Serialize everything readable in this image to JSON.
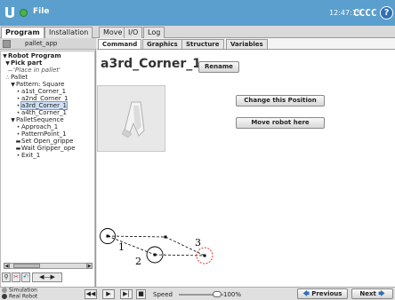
{
  "titlebar": {
    "file_label": "File",
    "time": "12:47:15",
    "robot_name": "CCCC",
    "help_label": "?"
  },
  "main_tabs": [
    "Program",
    "Installation",
    "Move",
    "I/O",
    "Log"
  ],
  "app": {
    "name": "pallet_app"
  },
  "tree": [
    {
      "label": "Robot Program",
      "glyph": "▼",
      "style": "bold"
    },
    {
      "label": "Pick part",
      "glyph": "▼",
      "style": "bold"
    },
    {
      "label": "'Place in pallet'",
      "glyph": "—",
      "style": "italic"
    },
    {
      "label": "Pallet",
      "glyph": "∴",
      "style": ""
    },
    {
      "label": "Pattern: Square",
      "glyph": "▼",
      "style": ""
    },
    {
      "label": "a1st_Corner_1",
      "glyph": "•",
      "style": ""
    },
    {
      "label": "a2nd_Corner_1",
      "glyph": "•",
      "style": ""
    },
    {
      "label": "a3rd_Corner_1",
      "glyph": "•",
      "style": "selected"
    },
    {
      "label": "a4th_Corner_1",
      "glyph": "•",
      "style": ""
    },
    {
      "label": "PalletSequence",
      "glyph": "▼",
      "style": ""
    },
    {
      "label": "Approach_1",
      "glyph": "•",
      "style": ""
    },
    {
      "label": "PatternPoint_1",
      "glyph": "•",
      "style": ""
    },
    {
      "label": "Set Open_grippe",
      "glyph": "▬",
      "style": ""
    },
    {
      "label": "Wait Gripper_ope",
      "glyph": "▬",
      "style": ""
    },
    {
      "label": "Exit_1",
      "glyph": "•",
      "style": ""
    }
  ],
  "sub_tabs": [
    "Command",
    "Graphics",
    "Structure",
    "Variables"
  ],
  "waypoint": {
    "name": "a3rd_Corner_1",
    "rename_label": "Rename",
    "change_label": "Change this Position",
    "move_label": "Move robot here"
  },
  "diagram_labels": [
    "1",
    "2",
    "3"
  ],
  "bottom": {
    "mode_simulation": "Simulation",
    "mode_real": "Real Robot",
    "speed_label": "Speed",
    "speed_value": "100%",
    "speed_fraction": 1.0,
    "previous_label": "Previous",
    "next_label": "Next"
  }
}
